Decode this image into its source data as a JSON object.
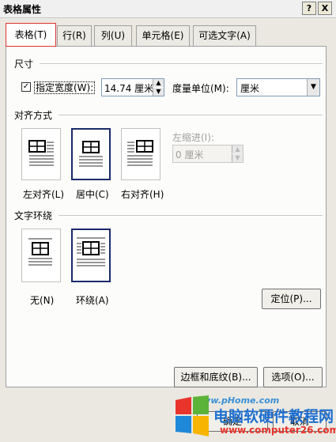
{
  "window": {
    "title": "表格属性",
    "help": "?",
    "close": "X"
  },
  "tabs": [
    {
      "label": "表格(T)"
    },
    {
      "label": "行(R)"
    },
    {
      "label": "列(U)"
    },
    {
      "label": "单元格(E)"
    },
    {
      "label": "可选文字(A)"
    }
  ],
  "size": {
    "section": "尺寸",
    "specify_width_label": "指定宽度(W):",
    "checked": true,
    "width_value": "14.74 厘米",
    "unit_label": "度量单位(M):",
    "unit_value": "厘米"
  },
  "alignment": {
    "section": "对齐方式",
    "indent_label": "左缩进(I):",
    "indent_value": "0 厘米",
    "options": [
      {
        "label": "左对齐(L)",
        "selected": false
      },
      {
        "label": "居中(C)",
        "selected": true
      },
      {
        "label": "右对齐(H)",
        "selected": false
      }
    ]
  },
  "wrapping": {
    "section": "文字环绕",
    "options": [
      {
        "label": "无(N)",
        "selected": false
      },
      {
        "label": "环绕(A)",
        "selected": true
      }
    ],
    "position_button": "定位(P)..."
  },
  "footer": {
    "borders_button": "边框和底纹(B)...",
    "options_button": "选项(O)...",
    "ok_button": "确定",
    "cancel_button": "取消"
  },
  "watermark": {
    "site_top": "www.pHome.com",
    "brand": "电脑软硬件教程网",
    "url": "www.computer26.com",
    "colors": {
      "red": "#e8342b",
      "green": "#5cb33a",
      "blue": "#1e88d9",
      "yellow": "#f7b500"
    }
  }
}
